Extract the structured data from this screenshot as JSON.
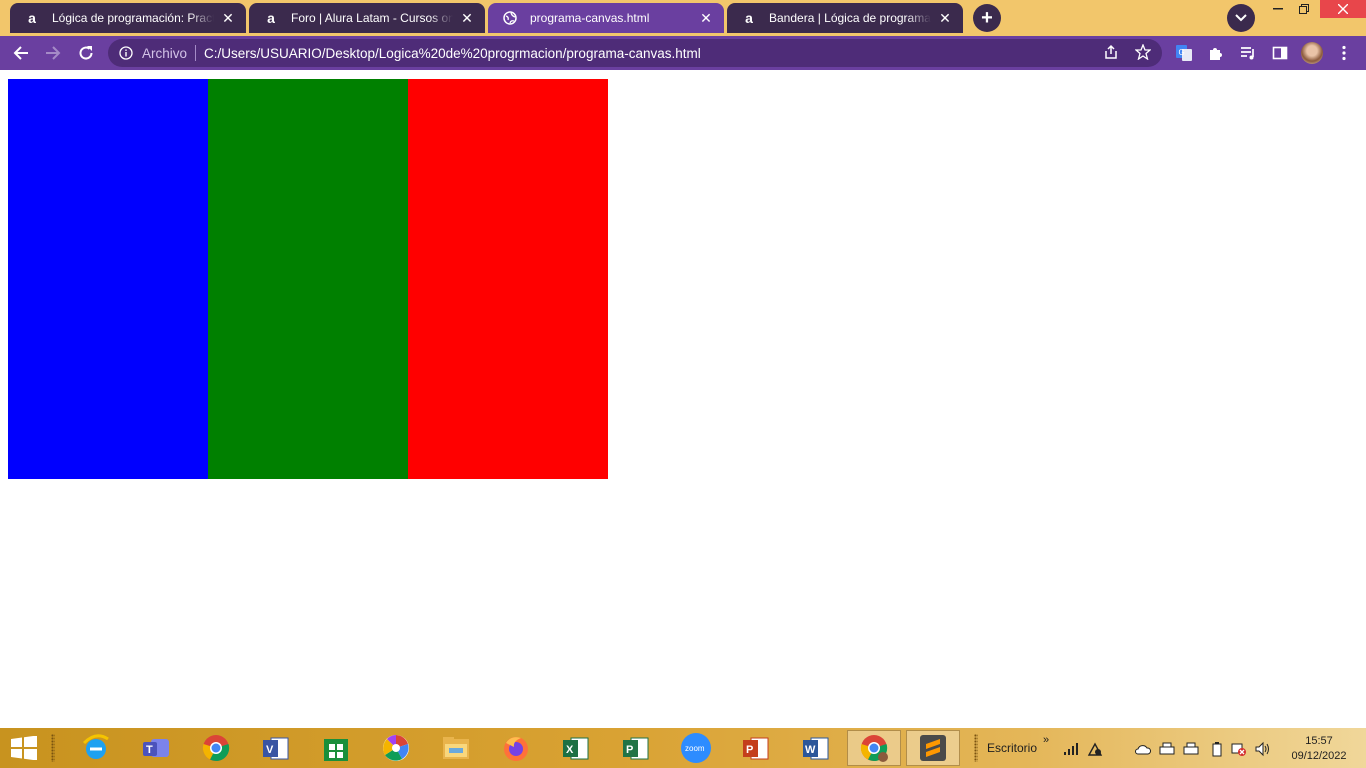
{
  "browser": {
    "tabs": [
      {
        "title": "Lógica de programación: Practica",
        "favicon": "alura-icon",
        "active": false
      },
      {
        "title": "Foro | Alura Latam - Cursos online",
        "favicon": "alura-icon",
        "active": false
      },
      {
        "title": "programa-canvas.html",
        "favicon": "globe-icon",
        "active": true
      },
      {
        "title": "Bandera | Lógica de programación",
        "favicon": "alura-icon",
        "active": false
      }
    ],
    "new_tab_symbol": "+",
    "address": {
      "scheme_label": "Archivo",
      "url": "C:/Users/USUARIO/Desktop/Logica%20de%20progrmacion/programa-canvas.html"
    },
    "theme": {
      "tabstrip": "#f2c66b",
      "toolbar": "#6a3fa0",
      "inactive_tab": "#3b2a4d"
    }
  },
  "canvas": {
    "stripes": [
      {
        "color": "#0000ff",
        "name": "blue"
      },
      {
        "color": "#008000",
        "name": "green"
      },
      {
        "color": "#ff0000",
        "name": "red"
      }
    ]
  },
  "taskbar": {
    "apps": [
      "internet-explorer-icon",
      "teams-icon",
      "chrome-icon",
      "visio-icon",
      "store-icon",
      "picasa-icon",
      "file-explorer-icon",
      "firefox-icon",
      "excel-icon",
      "project-icon",
      "zoom-icon",
      "powerpoint-icon",
      "word-icon",
      "chrome-active-icon",
      "sublime-icon"
    ],
    "zoom_label": "zoom",
    "toolbar_label": "Escritorio",
    "toolbar_chevron": "»",
    "clock": {
      "time": "15:57",
      "date": "09/12/2022"
    }
  }
}
